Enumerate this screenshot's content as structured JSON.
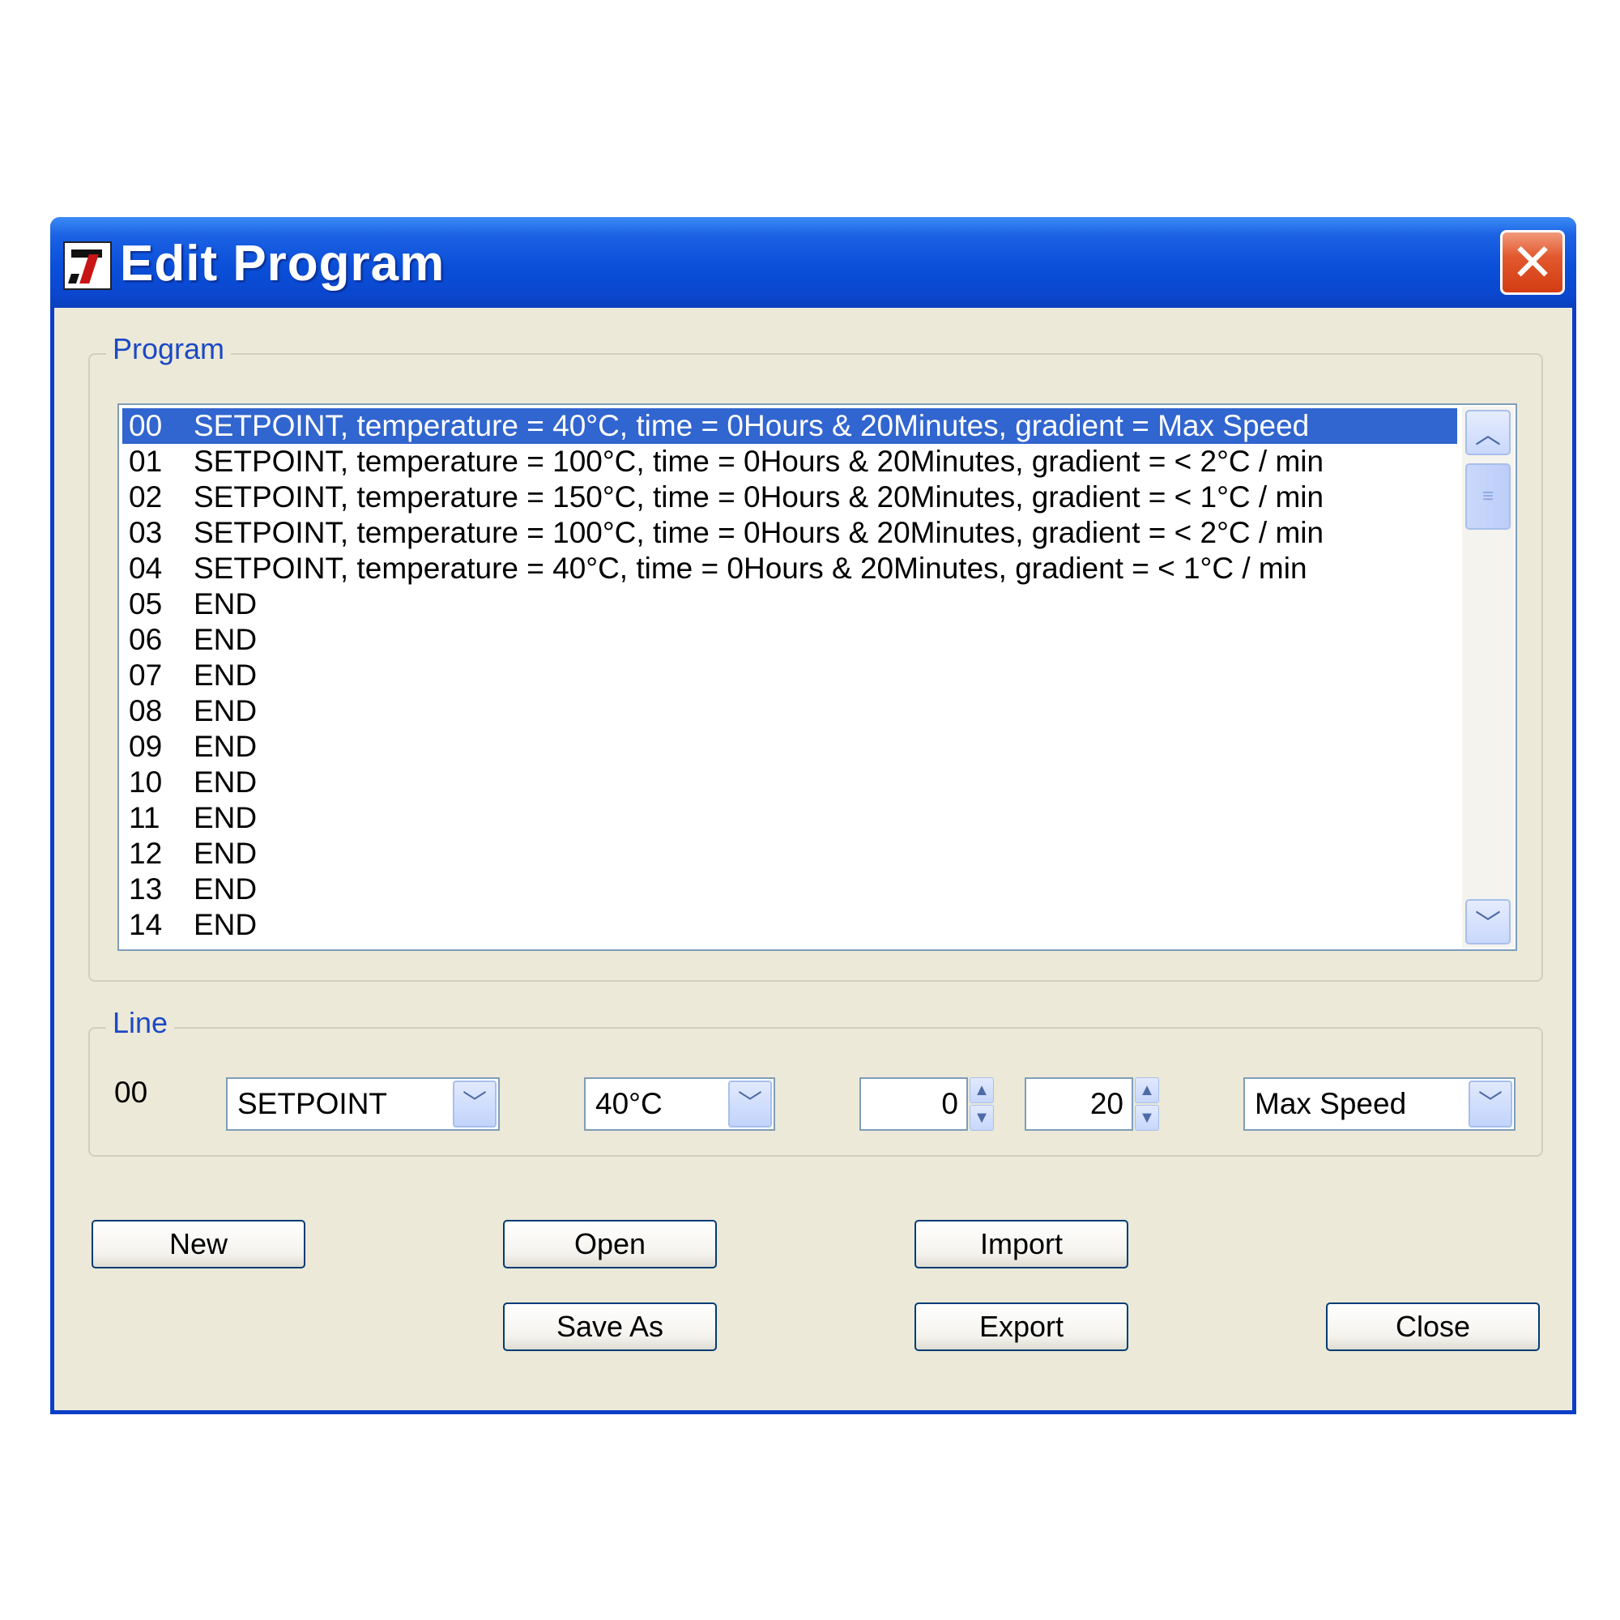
{
  "window": {
    "title": "Edit Program",
    "close_glyph": "✕"
  },
  "program_group": {
    "label": "Program"
  },
  "program_lines": [
    {
      "num": "00",
      "text": "SETPOINT, temperature = 40°C, time = 0Hours & 20Minutes, gradient = Max Speed"
    },
    {
      "num": "01",
      "text": "SETPOINT, temperature = 100°C, time = 0Hours & 20Minutes, gradient = < 2°C / min"
    },
    {
      "num": "02",
      "text": "SETPOINT, temperature = 150°C, time = 0Hours & 20Minutes, gradient = < 1°C / min"
    },
    {
      "num": "03",
      "text": "SETPOINT, temperature = 100°C, time = 0Hours & 20Minutes, gradient = < 2°C / min"
    },
    {
      "num": "04",
      "text": "SETPOINT, temperature = 40°C, time = 0Hours & 20Minutes, gradient = < 1°C / min"
    },
    {
      "num": "05",
      "text": "END"
    },
    {
      "num": "06",
      "text": "END"
    },
    {
      "num": "07",
      "text": "END"
    },
    {
      "num": "08",
      "text": "END"
    },
    {
      "num": "09",
      "text": "END"
    },
    {
      "num": "10",
      "text": "END"
    },
    {
      "num": "11",
      "text": "END"
    },
    {
      "num": "12",
      "text": "END"
    },
    {
      "num": "13",
      "text": "END"
    },
    {
      "num": "14",
      "text": "END"
    }
  ],
  "selected_line": "00",
  "line_group": {
    "label": "Line",
    "line_number": "00",
    "command": "SETPOINT",
    "temperature": "40°C",
    "hours": "0",
    "minutes": "20",
    "gradient": "Max Speed"
  },
  "buttons": {
    "new": "New",
    "open": "Open",
    "import": "Import",
    "save_as": "Save As",
    "export": "Export",
    "close": "Close"
  },
  "icons": {
    "scroll_up": "︿",
    "scroll_down": "﹀",
    "combo_arrow": "﹀",
    "spin_up": "▲",
    "spin_down": "▼",
    "thumb_grip": "≡"
  }
}
